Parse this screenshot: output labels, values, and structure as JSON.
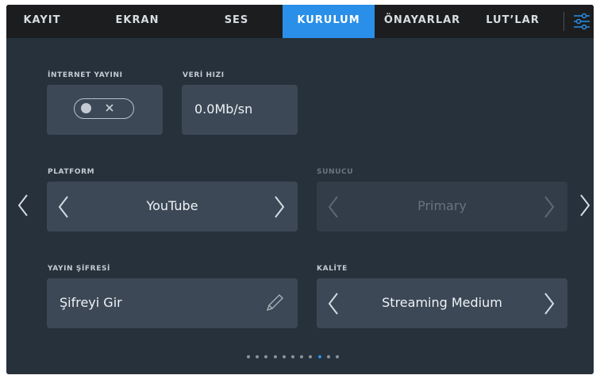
{
  "tabs": [
    {
      "label": "KAYIT",
      "active": false
    },
    {
      "label": "EKRAN",
      "active": false
    },
    {
      "label": "SES",
      "active": false
    },
    {
      "label": "KURULUM",
      "active": true
    },
    {
      "label": "ÖNAYARLAR",
      "active": false
    },
    {
      "label": "LUT’LAR",
      "active": false
    }
  ],
  "menu_icon": "sliders-icon",
  "internet": {
    "label": "İNTERNET YAYINI",
    "toggle_on": false,
    "toggle_icon": "close-icon"
  },
  "bitrate": {
    "label": "VERİ HIZI",
    "value": "0.0Mb/sn"
  },
  "platform": {
    "label": "PLATFORM",
    "value": "YouTube"
  },
  "server": {
    "label": "SUNUCU",
    "value": "Primary",
    "enabled": false
  },
  "stream_key": {
    "label": "YAYIN ŞİFRESİ",
    "value": "Şifreyi Gir",
    "icon": "pencil-icon"
  },
  "quality": {
    "label": "KALİTE",
    "value": "Streaming Medium"
  },
  "pagination": {
    "total": 11,
    "current": 9
  },
  "colors": {
    "accent": "#2a8fe8",
    "panel": "#26313b",
    "tabbar": "#1c1d1f",
    "box": "#3c4856"
  }
}
